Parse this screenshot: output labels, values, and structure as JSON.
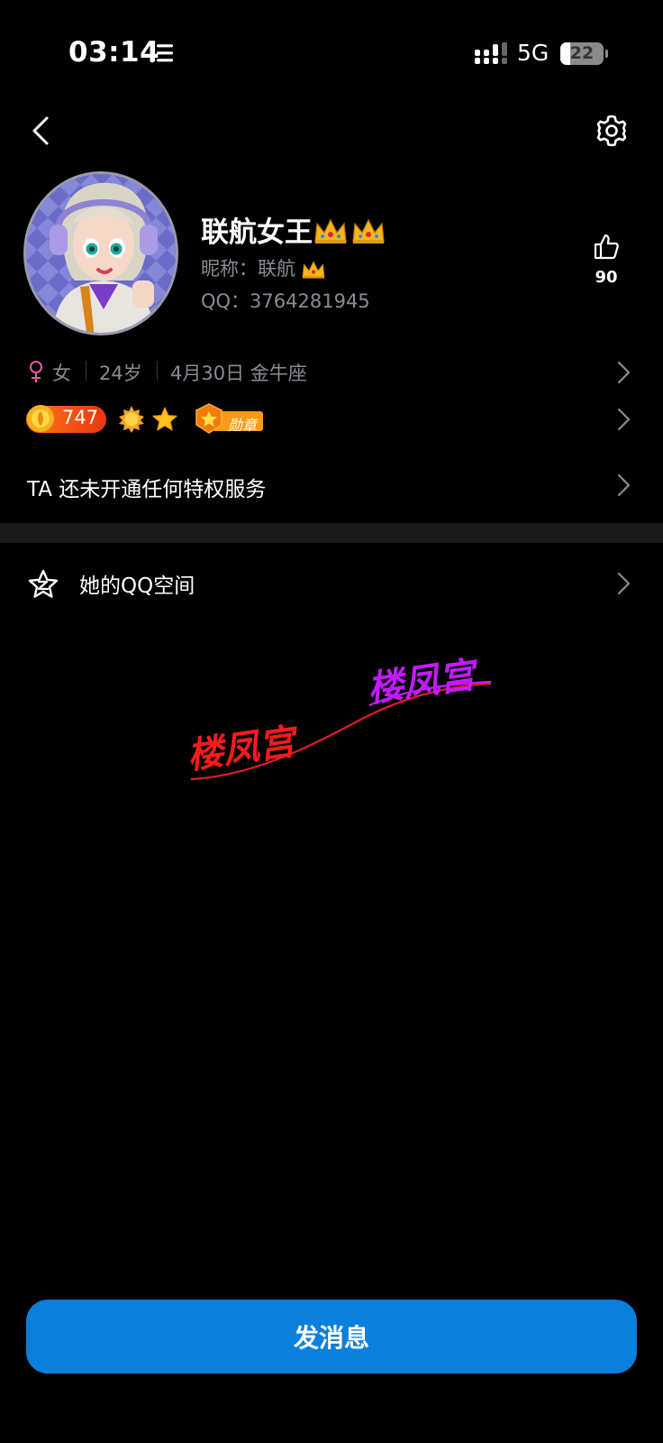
{
  "status_bar": {
    "time": "03:14",
    "network": "5G",
    "battery_level": 22,
    "battery_text": "22"
  },
  "nav": {
    "back_icon": "chevron-left-icon",
    "settings_icon": "gear-icon"
  },
  "profile": {
    "name": "联航女王",
    "name_emoji": "crown-icon",
    "nickname": "昵称：联航",
    "qq": "QQ：3764281945",
    "likes": "90"
  },
  "info": {
    "gender": "女",
    "age": "24岁",
    "birthday": "4月30日 金牛座"
  },
  "badges": {
    "level": "747",
    "medal_label": "勋章"
  },
  "privilege": {
    "text": "TA 还未开通任何特权服务"
  },
  "qzone": {
    "label": "她的QQ空间"
  },
  "watermark": {
    "text": "楼凤宫"
  },
  "actions": {
    "send_message": "发消息"
  },
  "colors": {
    "background": "#000000",
    "button": "#0a7fdb",
    "secondary_text": "#8b8b95",
    "gender": "#e35ca8",
    "watermark_red": "#ff1a1a",
    "watermark_purple": "#c21bff"
  }
}
